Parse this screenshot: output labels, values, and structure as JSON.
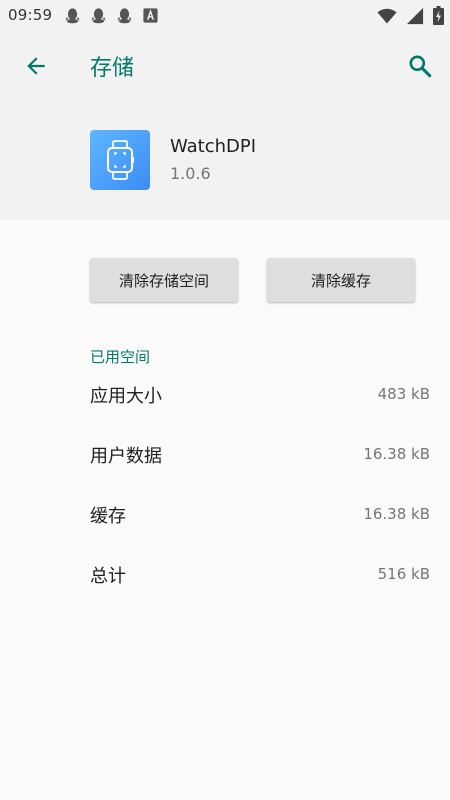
{
  "status_bar": {
    "time": "09:59",
    "notification_icons": [
      "qq-icon",
      "qq-icon",
      "qq-icon",
      "font-a-icon"
    ],
    "system_icons": [
      "wifi-icon",
      "signal-icon",
      "battery-charging-icon"
    ]
  },
  "toolbar": {
    "title": "存储",
    "back_icon": "arrow-back-icon",
    "search_icon": "search-icon",
    "accent_color": "#00796b"
  },
  "app": {
    "name": "WatchDPI",
    "version": "1.0.6",
    "icon": "watch-icon",
    "icon_color": "#4a9ef8"
  },
  "buttons": {
    "clear_storage": "清除存储空间",
    "clear_cache": "清除缓存"
  },
  "storage": {
    "section_title": "已用空间",
    "rows": [
      {
        "label": "应用大小",
        "value": "483 kB"
      },
      {
        "label": "用户数据",
        "value": "16.38 kB"
      },
      {
        "label": "缓存",
        "value": "16.38 kB"
      },
      {
        "label": "总计",
        "value": "516 kB"
      }
    ]
  }
}
